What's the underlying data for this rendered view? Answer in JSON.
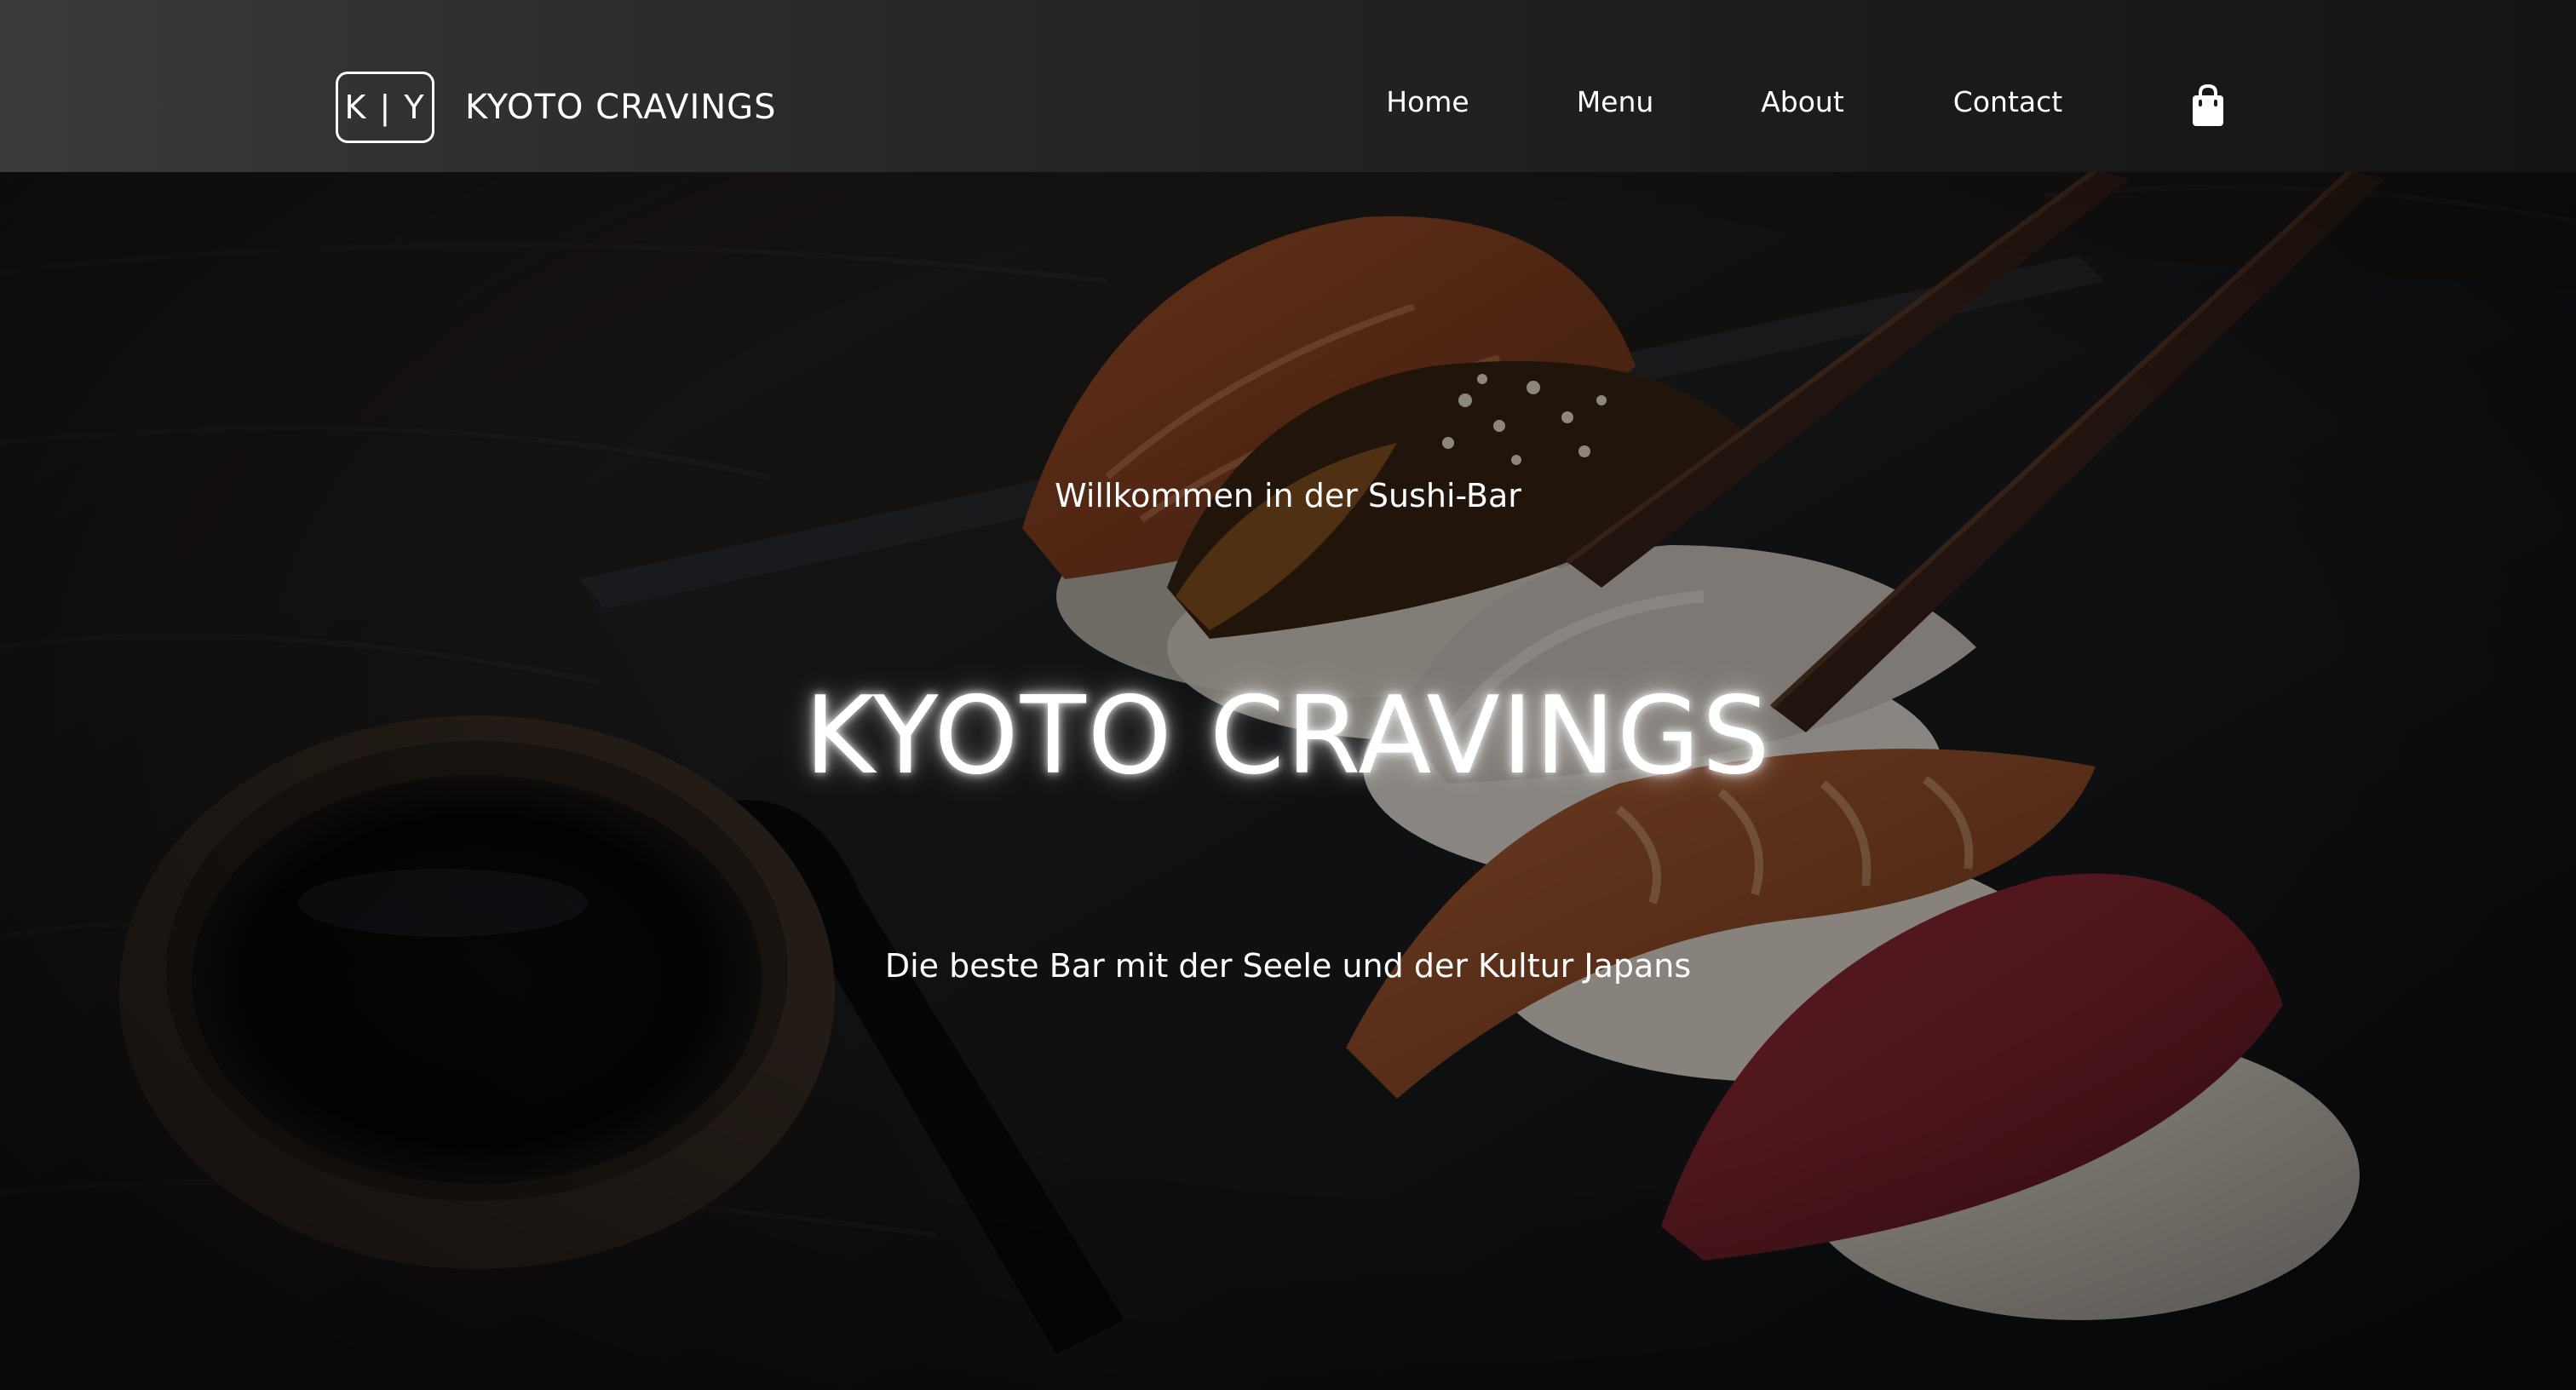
{
  "header": {
    "logo_text": "K | Y",
    "brand_name": "KYOTO CRAVINGS",
    "nav": {
      "home": "Home",
      "menu": "Menu",
      "about": "About",
      "contact": "Contact"
    },
    "cart_icon": "shopping-bag-icon"
  },
  "hero": {
    "subtitle": "Willkommen in der Sushi-Bar",
    "title": "KYOTO CRAVINGS",
    "tagline": "Die beste Bar mit der Seele und der Kultur Japans"
  },
  "colors": {
    "nav_background": "#2a2a2a",
    "text": "#ffffff",
    "overlay": "#000000"
  }
}
